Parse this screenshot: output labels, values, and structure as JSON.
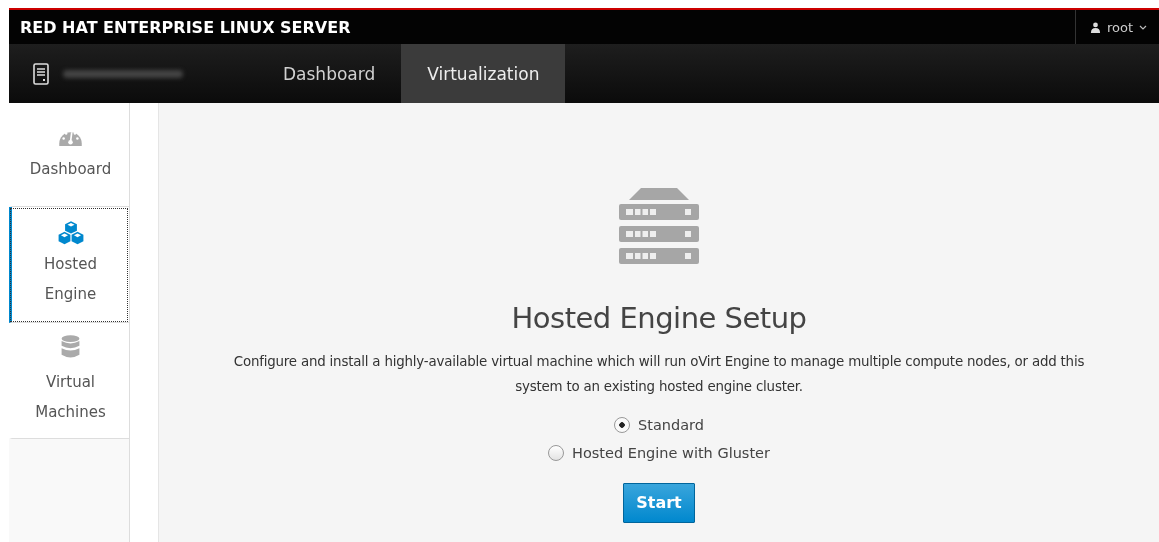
{
  "brand": "RED HAT ENTERPRISE LINUX SERVER",
  "user": {
    "name": "root"
  },
  "nav_tabs": [
    {
      "label": "Dashboard",
      "selected": false
    },
    {
      "label": "Virtualization",
      "selected": true
    }
  ],
  "sidebar": {
    "items": [
      {
        "label": "Dashboard",
        "kind": "gauge",
        "selected": false
      },
      {
        "label": "Hosted Engine",
        "kind": "cubes",
        "selected": true
      },
      {
        "label": "Virtual Machines",
        "kind": "database",
        "selected": false
      }
    ]
  },
  "main": {
    "title": "Hosted Engine Setup",
    "description": "Configure and install a highly-available virtual machine which will run oVirt Engine to manage multiple compute nodes, or add this system to an existing hosted engine cluster.",
    "options": [
      {
        "label": "Standard",
        "selected": true
      },
      {
        "label": "Hosted Engine with Gluster",
        "selected": false
      }
    ],
    "button": "Start"
  }
}
